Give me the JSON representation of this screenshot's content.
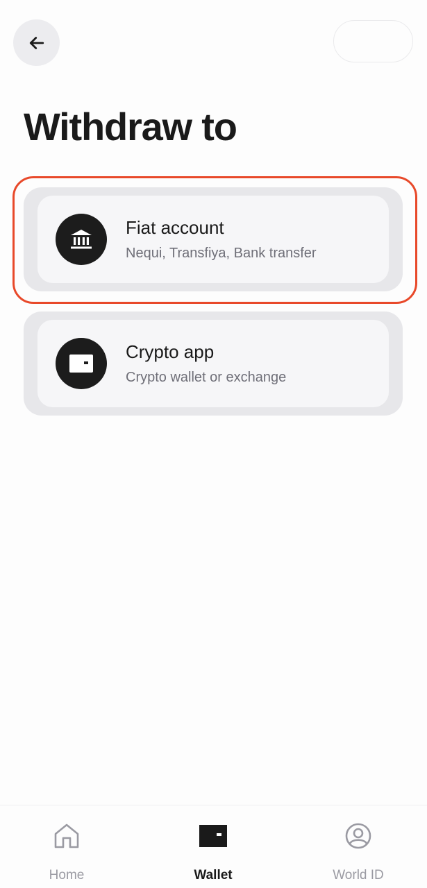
{
  "header": {
    "back_icon": "arrow-left-icon",
    "title": "Withdraw to"
  },
  "options": [
    {
      "title": "Fiat account",
      "subtitle": "Nequi, Transfiya, Bank transfer",
      "icon": "bank-icon",
      "highlighted": true
    },
    {
      "title": "Crypto app",
      "subtitle": "Crypto wallet or exchange",
      "icon": "wallet-icon",
      "highlighted": false
    }
  ],
  "nav": {
    "items": [
      {
        "label": "Home",
        "icon": "home-icon",
        "active": false
      },
      {
        "label": "Wallet",
        "icon": "wallet-icon",
        "active": true
      },
      {
        "label": "World ID",
        "icon": "user-circle-icon",
        "active": false
      }
    ]
  },
  "colors": {
    "highlight": "#e8492a",
    "icon_bg": "#1c1c1c",
    "card_outer": "#e7e7ea",
    "card_inner": "#f6f6f8",
    "inactive_nav": "#9a9aa2"
  }
}
